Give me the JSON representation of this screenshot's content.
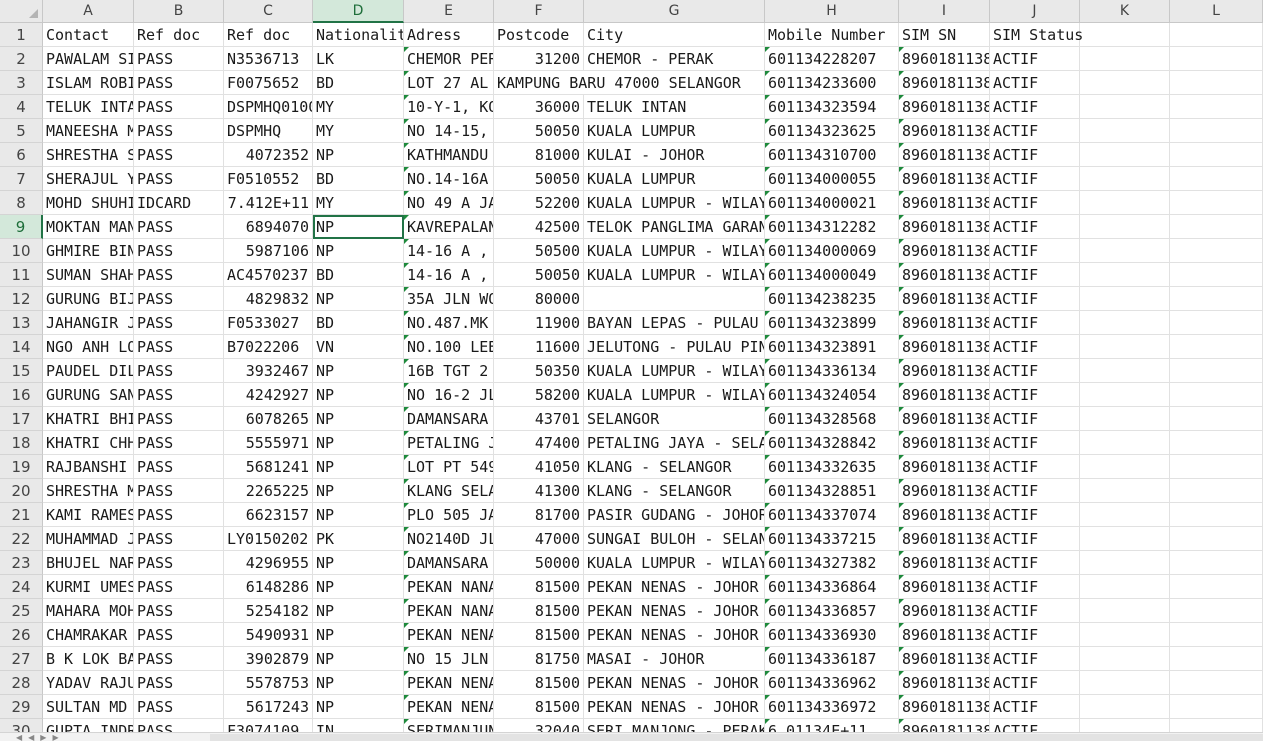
{
  "columns": [
    {
      "letter": "A"
    },
    {
      "letter": "B"
    },
    {
      "letter": "C"
    },
    {
      "letter": "D",
      "active": true
    },
    {
      "letter": "E"
    },
    {
      "letter": "F"
    },
    {
      "letter": "G"
    },
    {
      "letter": "H"
    },
    {
      "letter": "I"
    },
    {
      "letter": "J"
    },
    {
      "letter": "K"
    },
    {
      "letter": "L"
    }
  ],
  "active_row": 9,
  "rows": [
    [
      "Contact",
      "Ref doc",
      "Ref doc",
      "Nationality",
      "Adress",
      "Postcode",
      "City",
      "Mobile Number",
      "SIM SN",
      "SIM Status"
    ],
    [
      "PAWALAM SI",
      "PASS",
      "N3536713",
      "LK",
      "CHEMOR PER",
      "31200",
      "CHEMOR - PERAK",
      "601134228207",
      "8960181138",
      "ACTIF"
    ],
    [
      "ISLAM ROBI",
      "PASS",
      "F0075652",
      "BD",
      "LOT 27 AL",
      "",
      "KAMPUNG BARU 47000 SELANGOR",
      "601134233600",
      "8960181138",
      "ACTIF"
    ],
    [
      "TELUK INTA",
      "PASS",
      "DSPMHQ0100",
      "MY",
      "10-Y-1, KO",
      "36000",
      "TELUK INTAN",
      "601134323594",
      "8960181138",
      "ACTIF"
    ],
    [
      "MANEESHA M",
      "PASS",
      "DSPMHQ",
      "MY",
      "NO 14-15,",
      "50050",
      "KUALA LUMPUR",
      "601134323625",
      "8960181138",
      "ACTIF"
    ],
    [
      "SHRESTHA S",
      "PASS",
      "4072352",
      "NP",
      "KATHMANDU",
      "81000",
      "KULAI - JOHOR",
      "601134310700",
      "8960181138",
      "ACTIF"
    ],
    [
      "SHERAJUL Y",
      "PASS",
      "F0510552",
      "BD",
      "NO.14-16A",
      "50050",
      "KUALA LUMPUR",
      "601134000055",
      "8960181138",
      "ACTIF"
    ],
    [
      "MOHD SHUHI",
      "IDCARD",
      "7.412E+11",
      "MY",
      "NO 49 A JA",
      "52200",
      "KUALA LUMPUR - WILAY",
      "601134000021",
      "8960181138",
      "ACTIF"
    ],
    [
      "MOKTAN MAN",
      "PASS",
      "6894070",
      "NP",
      "KAVREPALAN",
      "42500",
      "TELOK PANGLIMA GARAN",
      "601134312282",
      "8960181138",
      "ACTIF"
    ],
    [
      "GHMIRE BIN",
      "PASS",
      "5987106",
      "NP",
      "14-16 A ,",
      "50500",
      "KUALA LUMPUR - WILAY",
      "601134000069",
      "8960181138",
      "ACTIF"
    ],
    [
      "SUMAN SHAH",
      "PASS",
      "AC4570237",
      "BD",
      "14-16 A ,",
      "50050",
      "KUALA LUMPUR - WILAY",
      "601134000049",
      "8960181138",
      "ACTIF"
    ],
    [
      "GURUNG BIJ",
      "PASS",
      "4829832",
      "NP",
      "35A JLN WO",
      "80000",
      "",
      "601134238235",
      "8960181138",
      "ACTIF"
    ],
    [
      "JAHANGIR J",
      "PASS",
      "F0533027",
      "BD",
      "NO.487.MK",
      "11900",
      "BAYAN LEPAS - PULAU",
      "601134323899",
      "8960181138",
      "ACTIF"
    ],
    [
      "NGO ANH LO",
      "PASS",
      "B7022206",
      "VN",
      "NO.100 LEB",
      "11600",
      "JELUTONG - PULAU PIN",
      "601134323891",
      "8960181138",
      "ACTIF"
    ],
    [
      "PAUDEL DIL",
      "PASS",
      "3932467",
      "NP",
      "16B  TGT 2",
      "50350",
      "KUALA LUMPUR - WILAY",
      "601134336134",
      "8960181138",
      "ACTIF"
    ],
    [
      "GURUNG SAN",
      "PASS",
      "4242927",
      "NP",
      "NO 16-2 JL",
      "58200",
      "KUALA LUMPUR - WILAY",
      "601134324054",
      "8960181138",
      "ACTIF"
    ],
    [
      "KHATRI BHI",
      "PASS",
      "6078265",
      "NP",
      "DAMANSARA",
      "43701",
      "SELANGOR",
      "601134328568",
      "8960181138",
      "ACTIF"
    ],
    [
      "KHATRI CHH",
      "PASS",
      "5555971",
      "NP",
      "PETALING J",
      "47400",
      "PETALING JAYA - SELA",
      "601134328842",
      "8960181138",
      "ACTIF"
    ],
    [
      "RAJBANSHI",
      "PASS",
      "5681241",
      "NP",
      "LOT PT 549",
      "41050",
      "KLANG - SELANGOR",
      "601134332635",
      "8960181138",
      "ACTIF"
    ],
    [
      "SHRESTHA M",
      "PASS",
      "2265225",
      "NP",
      "KLANG SELA",
      "41300",
      "KLANG - SELANGOR",
      "601134328851",
      "8960181138",
      "ACTIF"
    ],
    [
      "KAMI RAMES",
      "PASS",
      "6623157",
      "NP",
      "PLO 505 JA",
      "81700",
      "PASIR GUDANG - JOHOR",
      "601134337074",
      "8960181138",
      "ACTIF"
    ],
    [
      "MUHAMMAD J",
      "PASS",
      "LY0150202",
      "PK",
      "NO2140D JL",
      "47000",
      "SUNGAI BULOH - SELAN",
      "601134337215",
      "8960181138",
      "ACTIF"
    ],
    [
      "BHUJEL NAR",
      "PASS",
      "4296955",
      "NP",
      "DAMANSARA",
      "50000",
      "KUALA LUMPUR - WILAY",
      "601134327382",
      "8960181138",
      "ACTIF"
    ],
    [
      "KURMI UMES",
      "PASS",
      "6148286",
      "NP",
      "PEKAN NANA",
      "81500",
      "PEKAN NENAS - JOHOR",
      "601134336864",
      "8960181138",
      "ACTIF"
    ],
    [
      "MAHARA MOH",
      "PASS",
      "5254182",
      "NP",
      "PEKAN NANA",
      "81500",
      "PEKAN NENAS - JOHOR",
      "601134336857",
      "8960181138",
      "ACTIF"
    ],
    [
      "CHAMRAKAR",
      "PASS",
      "5490931",
      "NP",
      "PEKAN NENA",
      "81500",
      "PEKAN NENAS - JOHOR",
      "601134336930",
      "8960181138",
      "ACTIF"
    ],
    [
      "B K LOK BA",
      "PASS",
      "3902879",
      "NP",
      "NO 15 JLN",
      "81750",
      "MASAI - JOHOR",
      "601134336187",
      "8960181138",
      "ACTIF"
    ],
    [
      "YADAV RAJU",
      "PASS",
      "5578753",
      "NP",
      "PEKAN NENA",
      "81500",
      "PEKAN NENAS - JOHOR",
      "601134336962",
      "8960181138",
      "ACTIF"
    ],
    [
      "SULTAN MD",
      "PASS",
      "5617243",
      "NP",
      "PEKAN NENA",
      "81500",
      "PEKAN NENAS - JOHOR",
      "601134336972",
      "8960181138",
      "ACTIF"
    ],
    [
      "GUPTA INDR",
      "PASS",
      "F3074109",
      "IN",
      "SERIMANJUN",
      "32040",
      "SERI MANJONG - PERAK",
      "6.01134E+11",
      "8960181138",
      "ACTIF"
    ]
  ]
}
